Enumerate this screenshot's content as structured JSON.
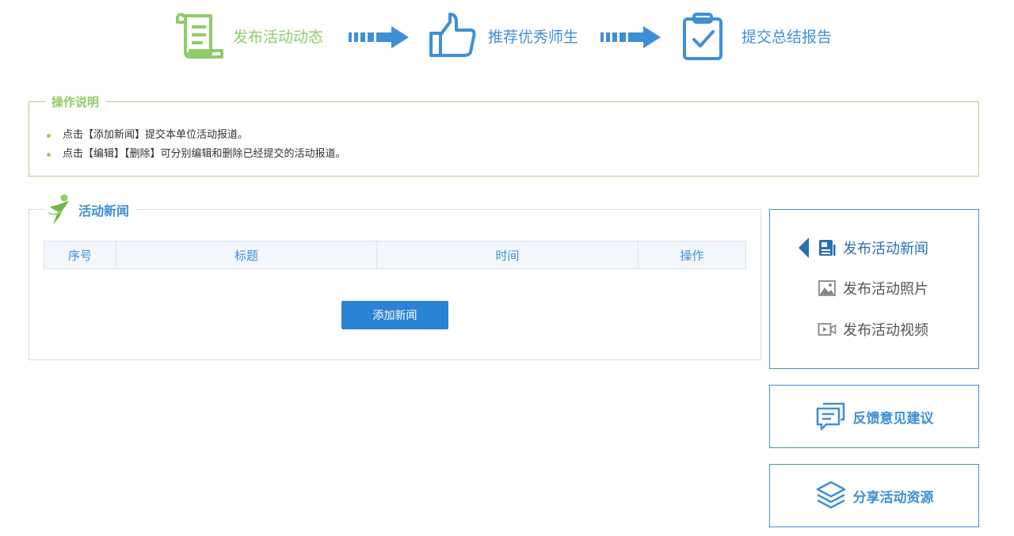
{
  "steps": [
    {
      "label": "发布活动动态",
      "icon": "scroll-icon",
      "color": "#8fcd6b"
    },
    {
      "label": "推荐优秀师生",
      "icon": "thumbs-up-icon",
      "color": "#3f8fd6"
    },
    {
      "label": "提交总结报告",
      "icon": "clipboard-check-icon",
      "color": "#3f8fd6"
    }
  ],
  "instructions": {
    "title": "操作说明",
    "items": [
      "点击【添加新闻】提交本单位活动报道。",
      "点击【编辑】【删除】可分别编辑和删除已经提交的活动报道。"
    ]
  },
  "news": {
    "title": "活动新闻",
    "columns": [
      "序号",
      "标题",
      "时间",
      "操作"
    ],
    "add_button": "添加新闻"
  },
  "side_menu": {
    "items": [
      {
        "label": "发布活动新闻",
        "icon": "news-icon",
        "active": true
      },
      {
        "label": "发布活动照片",
        "icon": "image-icon",
        "active": false
      },
      {
        "label": "发布活动视频",
        "icon": "video-icon",
        "active": false
      }
    ]
  },
  "feedback": {
    "label": "反馈意见建议",
    "icon": "chat-bubbles-icon"
  },
  "share": {
    "label": "分享活动资源",
    "icon": "layers-icon"
  },
  "colors": {
    "green": "#8fcd6b",
    "blue": "#3f8fd6",
    "button": "#2b84d3"
  }
}
